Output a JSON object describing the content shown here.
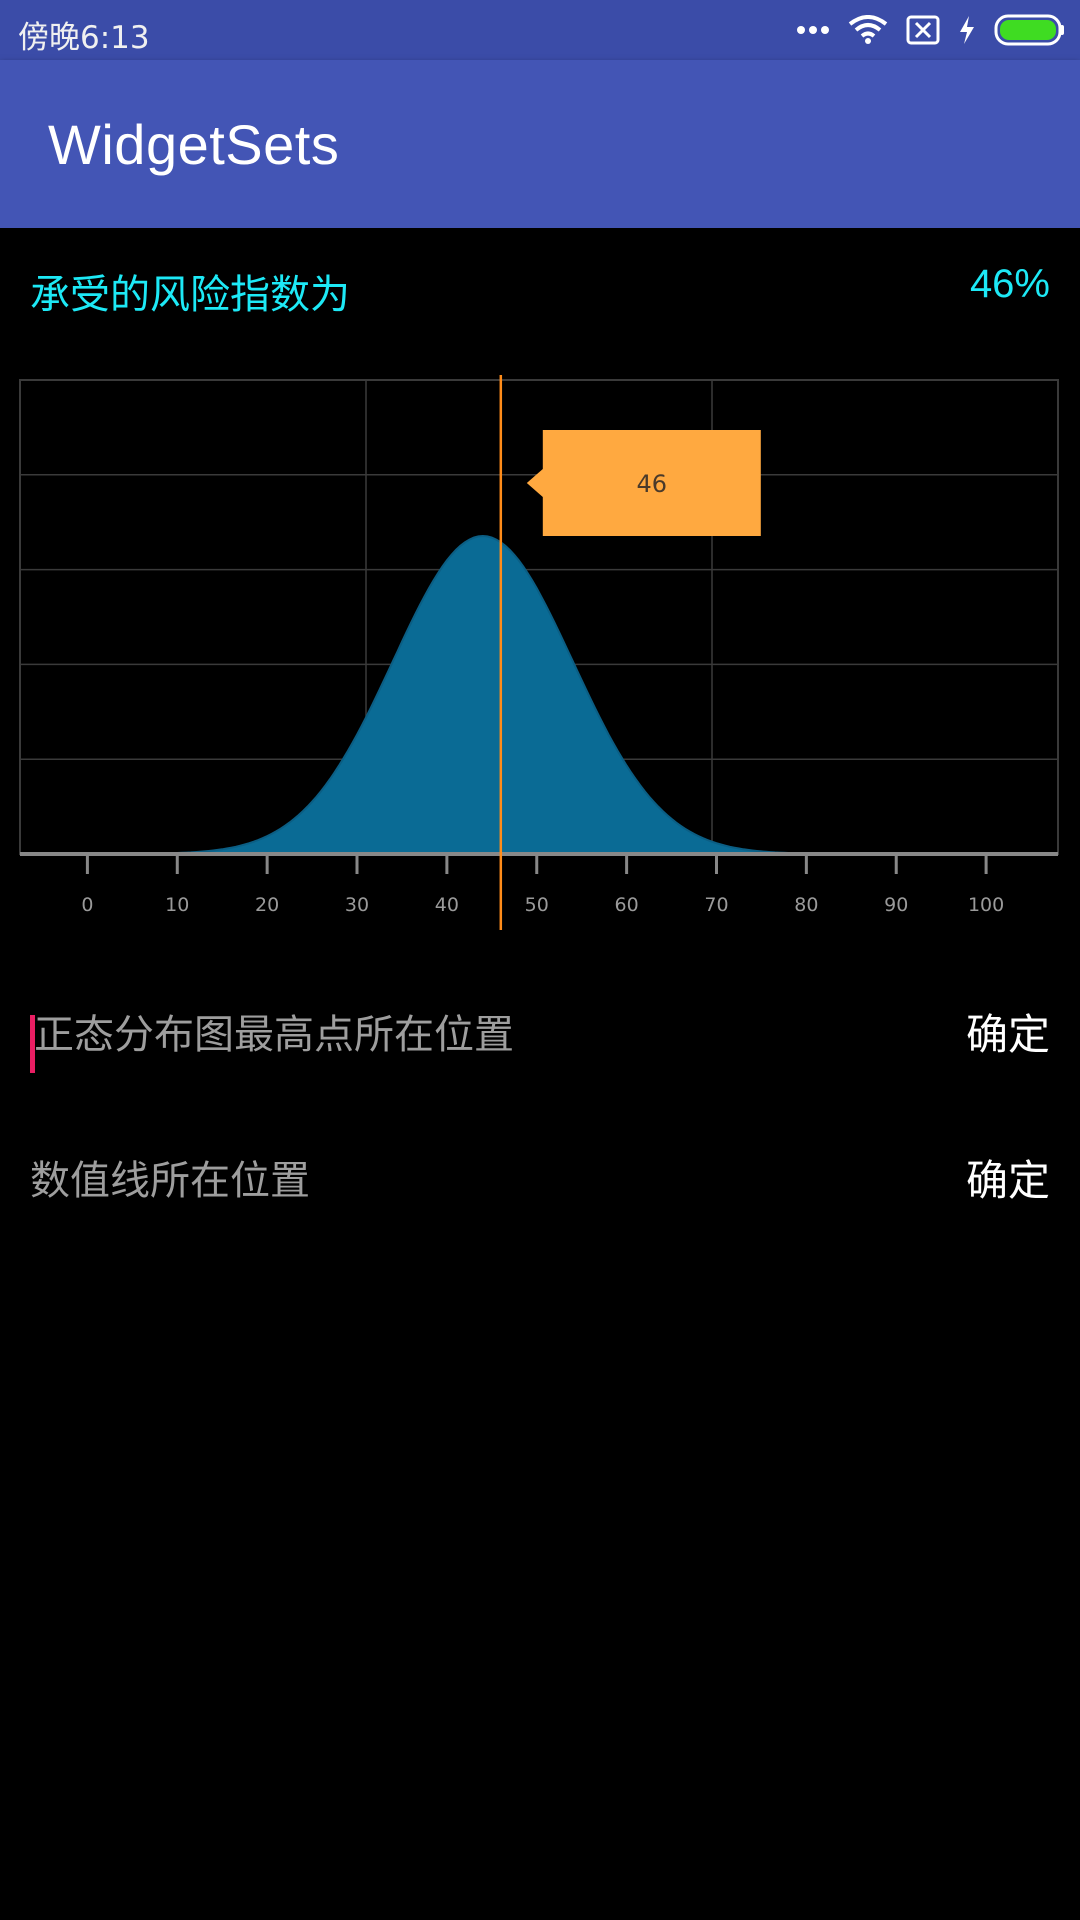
{
  "status": {
    "time": "傍晚6:13"
  },
  "app": {
    "title": "WidgetSets"
  },
  "risk": {
    "label": "承受的风险指数为",
    "value": "46%"
  },
  "chart_data": {
    "type": "area",
    "mean": 44,
    "std_dev": 10,
    "xlim": [
      -7.5,
      108
    ],
    "x_ticks": [
      0,
      10,
      20,
      30,
      40,
      50,
      60,
      70,
      80,
      90,
      100
    ],
    "x_tick_labels": [
      "0",
      "10",
      "20",
      "30",
      "40",
      "50",
      "60",
      "70",
      "80",
      "90",
      "100"
    ],
    "marker_value": 46,
    "marker_label": "46",
    "grid": true,
    "colors": {
      "fill": "#0a6b95",
      "marker": "#ff8c1a",
      "tooltip": "#ffa940",
      "grid": "#3a3a3a",
      "axis": "#888888",
      "tick_label": "#9a9a9a"
    }
  },
  "peak_row": {
    "placeholder": "正态分布图最高点所在位置",
    "button": "确定"
  },
  "line_row": {
    "placeholder": "数值线所在位置",
    "button": "确定"
  },
  "icons": [
    "more-dots-icon",
    "wifi-icon",
    "no-sim-icon",
    "charging-bolt-icon",
    "battery-icon"
  ],
  "colors": {
    "status_bar": "#3b4ca8",
    "app_bar": "#4355b5",
    "accent_text": "#1de9f6",
    "cursor": "#e91e63"
  }
}
